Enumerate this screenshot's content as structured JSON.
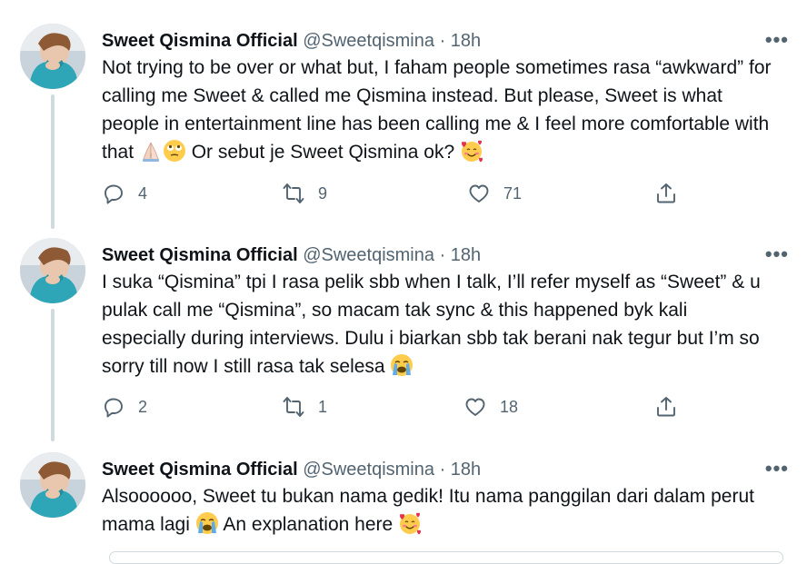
{
  "tweets": [
    {
      "name": "Sweet Qismina Official",
      "handle": "@Sweetqismina",
      "separator": "·",
      "time": "18h",
      "more": "•••",
      "segments": [
        "Not trying to be over or what but, I faham people sometimes rasa “awkward” for calling me Sweet & called me Qismina instead. But please, Sweet is what people in entertainment line has been calling me & I feel more comfortable with that ",
        " Or sebut je Sweet Qismina ok? "
      ],
      "emojis": [
        "folded-hands-emoji",
        "rolling-eyes-emoji",
        "smiling-face-with-hearts-emoji"
      ],
      "replies": "4",
      "retweets": "9",
      "likes": "71"
    },
    {
      "name": "Sweet Qismina Official",
      "handle": "@Sweetqismina",
      "separator": "·",
      "time": "18h",
      "more": "•••",
      "segments": [
        "I suka “Qismina” tpi I rasa pelik sbb when I talk, I’ll refer myself as “Sweet” & u pulak call me “Qismina”, so macam tak sync & this happened byk kali especially during interviews. Dulu i biarkan sbb tak berani nak tegur but I’m so sorry till now I still rasa tak selesa "
      ],
      "emojis": [
        "loudly-crying-face-emoji"
      ],
      "replies": "2",
      "retweets": "1",
      "likes": "18"
    },
    {
      "name": "Sweet Qismina Official",
      "handle": "@Sweetqismina",
      "separator": "·",
      "time": "18h",
      "more": "•••",
      "segments": [
        "Alsoooooo, Sweet tu bukan nama gedik! Itu nama panggilan dari dalam perut mama lagi ",
        " An explanation here "
      ],
      "emojis": [
        "loudly-crying-face-emoji",
        "smiling-face-with-hearts-emoji"
      ]
    }
  ],
  "colors": {
    "text": "#0f1419",
    "secondary": "#536471",
    "thread_line": "#cfd9de",
    "emoji_yellow": "#ffcc4d"
  }
}
